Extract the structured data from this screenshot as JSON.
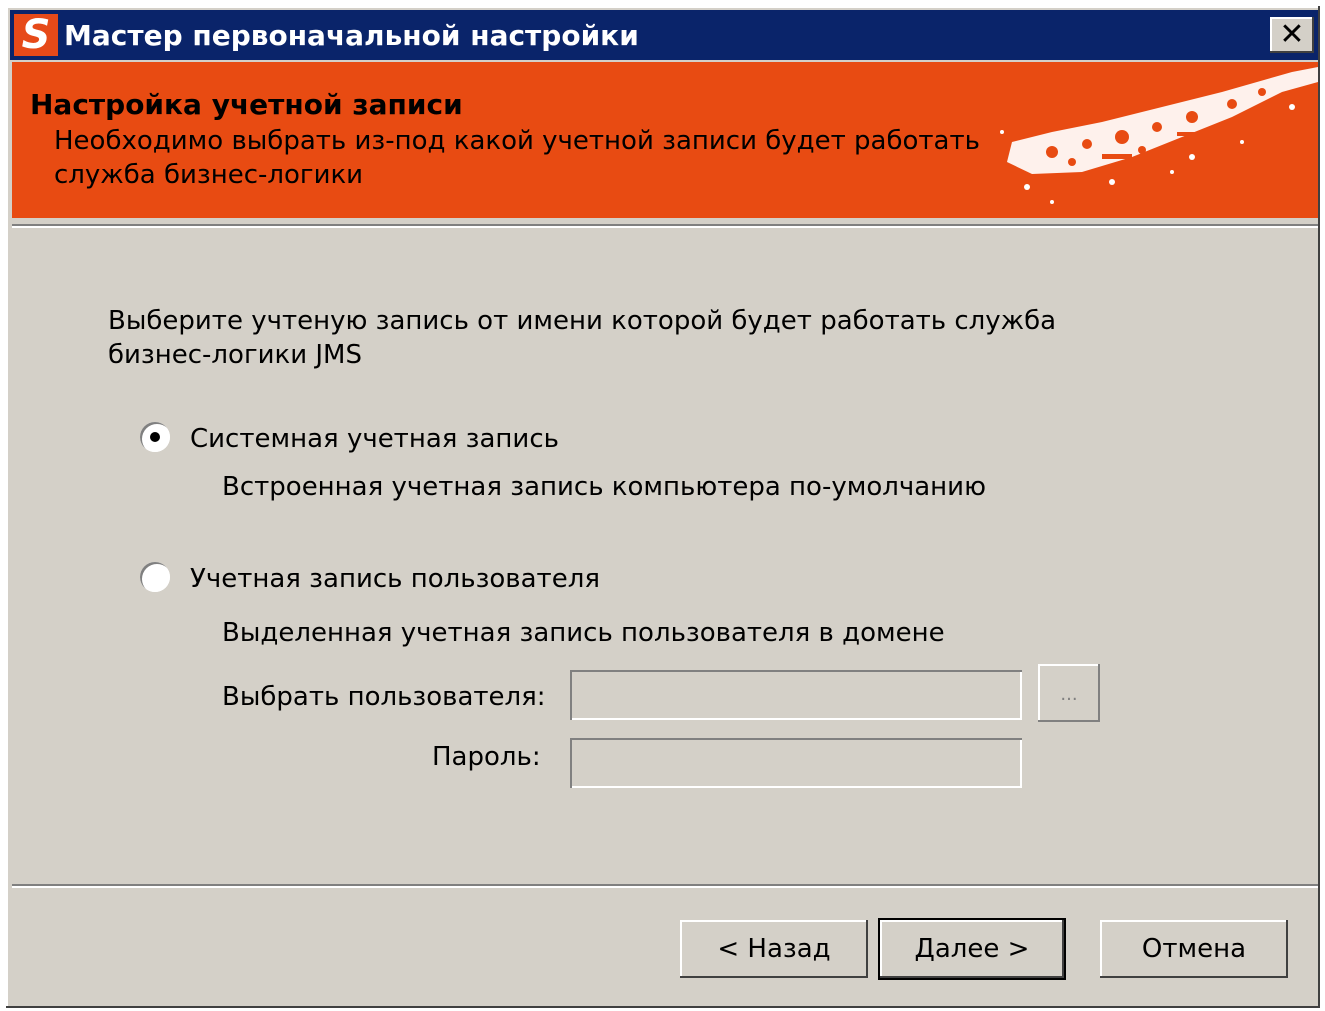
{
  "window": {
    "title": "Мастер первоначальной настройки",
    "app_icon_letter": "S",
    "close_glyph": "✕"
  },
  "banner": {
    "title": "Настройка учетной записи",
    "subtitle": "Необходимо выбрать из-под какой учетной записи будет работать служба бизнес-логики",
    "accent_color": "#e84b12"
  },
  "main": {
    "intro": "Выберите учтеную запись от имени которой будет работать служба бизнес-логики JMS",
    "options": [
      {
        "label": "Системная учетная запись",
        "description": "Встроенная учетная запись компьютера по-умолчанию",
        "selected": true
      },
      {
        "label": "Учетная запись пользователя",
        "description": "Выделенная учетная запись пользователя в домене",
        "selected": false
      }
    ],
    "user_field": {
      "label": "Выбрать пользователя:",
      "value": "",
      "browse_label": "..."
    },
    "password_field": {
      "label": "Пароль:",
      "value": ""
    }
  },
  "footer": {
    "back_label": "< Назад",
    "next_label": "Далее >",
    "cancel_label": "Отмена"
  }
}
